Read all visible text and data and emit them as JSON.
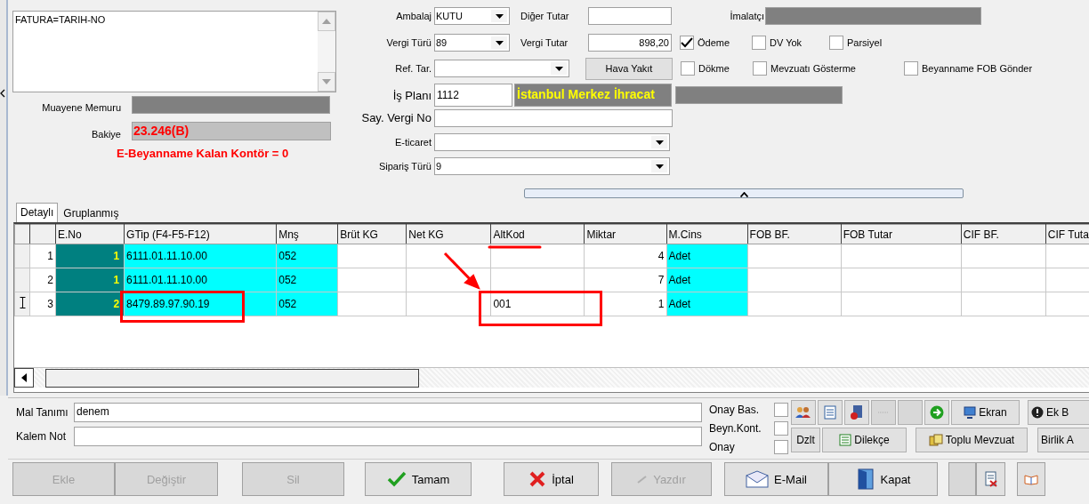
{
  "memo": {
    "value": "FATURA=TARIH-NO"
  },
  "muayene_memuru": {
    "label": "Muayene Memuru"
  },
  "bakiye": {
    "label": "Bakiye",
    "value": "23.246(B)"
  },
  "kontor_message": "E-Beyanname Kalan Kontör = 0",
  "ambalaj": {
    "label": "Ambalaj",
    "value": "KUTU"
  },
  "diger_tutar": {
    "label": "Diğer Tutar"
  },
  "imalatci": {
    "label": "İmalatçı"
  },
  "vergi_turu": {
    "label": "Vergi Türü",
    "value": "89"
  },
  "vergi_tutar": {
    "label": "Vergi Tutar",
    "value": "898,20"
  },
  "ref_tar": {
    "label": "Ref. Tar."
  },
  "hava_yakit_button": "Hava Yakıt",
  "is_plani": {
    "label": "İş Planı",
    "value": "1112",
    "office": "İstanbul Merkez İhracat"
  },
  "say_vergi_no": {
    "label": "Say. Vergi No"
  },
  "e_ticaret": {
    "label": "E-ticaret"
  },
  "siparis_turu": {
    "label": "Sipariş Türü",
    "value": "9"
  },
  "options": [
    {
      "label": "Ödeme",
      "checked": true
    },
    {
      "label": "DV Yok",
      "checked": false
    },
    {
      "label": "Parsiyel",
      "checked": false
    },
    {
      "label": "Dökme",
      "checked": false
    },
    {
      "label": "Mevzuatı Gösterme",
      "checked": false
    },
    {
      "label": "Beyanname FOB Gönder",
      "checked": false
    }
  ],
  "tabs": [
    {
      "label": "Detaylı",
      "selected": true
    },
    {
      "label": "Gruplanmış",
      "selected": false
    }
  ],
  "table": {
    "columns": [
      {
        "label": "E.No",
        "kind": "index"
      },
      {
        "label": "GTip (F4-F5-F12)",
        "kind": "lookup"
      },
      {
        "label": "Mnş",
        "kind": "lookup"
      },
      {
        "label": "Brüt KG",
        "kind": "number"
      },
      {
        "label": "Net KG",
        "kind": "number"
      },
      {
        "label": "AltKod",
        "kind": "text"
      },
      {
        "label": "Miktar",
        "kind": "number"
      },
      {
        "label": "M.Cins",
        "kind": "lookup"
      },
      {
        "label": "FOB BF.",
        "kind": "number"
      },
      {
        "label": "FOB Tutar",
        "kind": "number"
      },
      {
        "label": "CIF BF.",
        "kind": "number"
      },
      {
        "label": "CIF Tuta",
        "kind": "number"
      }
    ],
    "rows": [
      {
        "no": "1",
        "current": false,
        "cells": [
          "1",
          "6111.01.11.10.00",
          "052",
          null,
          null,
          null,
          "4",
          "Adet",
          null,
          null,
          null,
          null
        ]
      },
      {
        "no": "2",
        "current": false,
        "cells": [
          "1",
          "6111.01.11.10.00",
          "052",
          null,
          null,
          null,
          "7",
          "Adet",
          null,
          null,
          null,
          null
        ]
      },
      {
        "no": "3",
        "current": true,
        "cells": [
          "2",
          "8479.89.97.90.19",
          "052",
          null,
          null,
          "001",
          "1",
          "Adet",
          null,
          null,
          null,
          null
        ]
      }
    ]
  },
  "mal_tanimi": {
    "label": "Mal Tanımı",
    "value": "denem"
  },
  "kalem_not": {
    "label": "Kalem Not"
  },
  "flags": [
    {
      "label": "Onay Bas.",
      "checked": false
    },
    {
      "label": "Beyn.Kont.",
      "checked": false
    },
    {
      "label": "Onay",
      "checked": false
    }
  ],
  "toolbar_row1": [
    "Ekran",
    "Ek B"
  ],
  "toolbar_row2": [
    "Dzlt",
    "Dilekçe",
    "Toplu Mevzuat",
    "Birlik A"
  ],
  "action_buttons": [
    {
      "label": "Ekle",
      "disabled": true
    },
    {
      "label": "Değiştir",
      "disabled": true
    },
    {
      "label": "Sil",
      "disabled": true
    },
    {
      "label": "Tamam",
      "disabled": false
    },
    {
      "label": "İptal",
      "disabled": false
    },
    {
      "label": "Yazdır",
      "disabled": true
    },
    {
      "label": "E-Mail",
      "disabled": false
    },
    {
      "label": "Kapat",
      "disabled": false
    }
  ]
}
